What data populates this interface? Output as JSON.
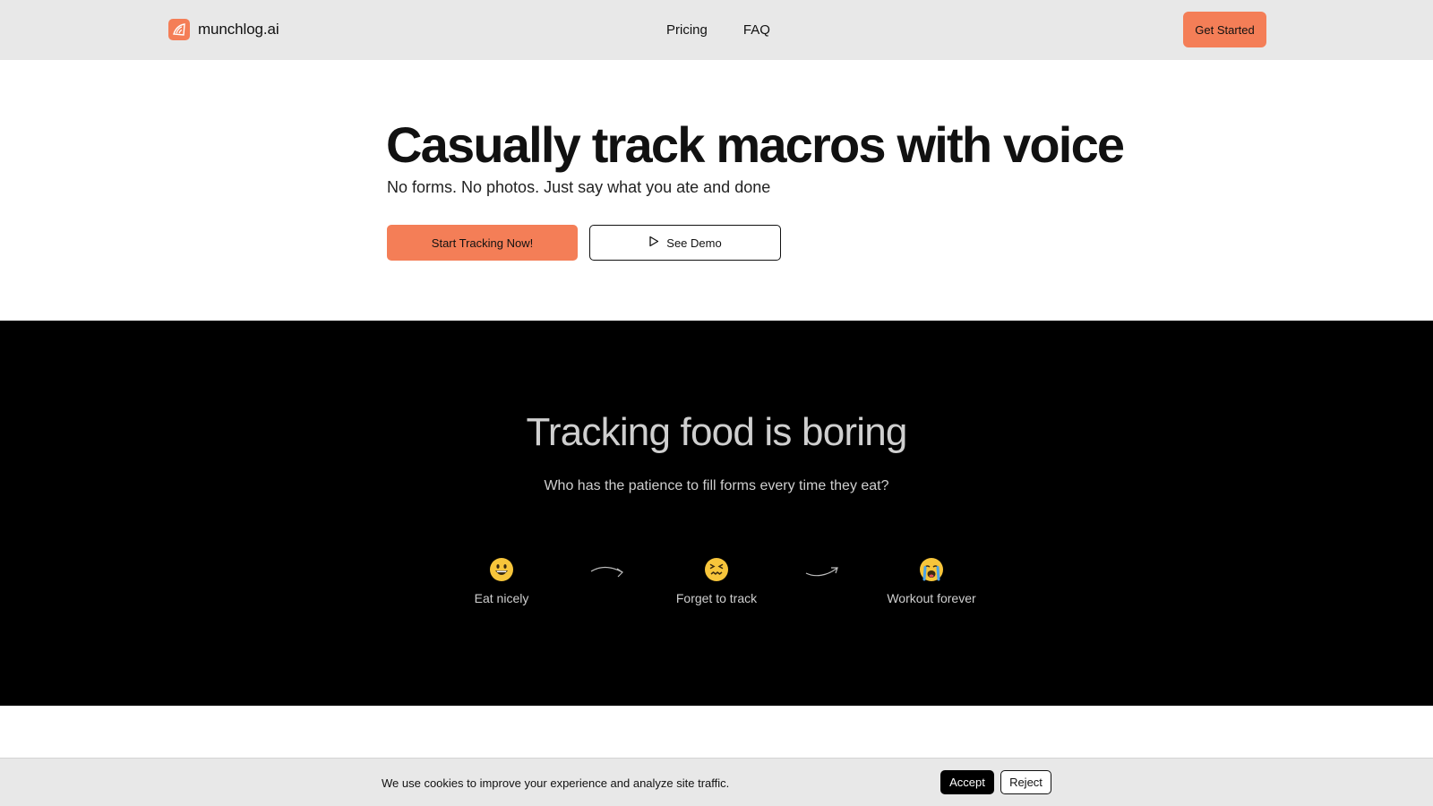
{
  "nav": {
    "brand": "munchlog.ai",
    "logo_icon": "munchlog-logo-icon",
    "links": [
      "Pricing",
      "FAQ"
    ],
    "cta": "Get Started"
  },
  "hero": {
    "title": "Casually track macros with voice",
    "subtitle": "No forms. No photos. Just say what you ate and done",
    "primary_cta": "Start Tracking Now!",
    "secondary_cta": "See Demo",
    "secondary_icon": "play-icon"
  },
  "problem": {
    "title": "Tracking food is boring",
    "subtitle": "Who has the patience to fill forms every time they eat?",
    "steps": [
      {
        "emoji": "grinning-face-icon",
        "label": "Eat nicely"
      },
      {
        "emoji": "confounded-face-icon",
        "label": "Forget to track"
      },
      {
        "emoji": "crying-face-icon",
        "label": "Workout forever"
      }
    ]
  },
  "cookie": {
    "text": "We use cookies to improve your experience and analyze site traffic.",
    "accept": "Accept",
    "reject": "Reject"
  },
  "colors": {
    "accent": "#f47e57",
    "nav_bg": "#e8e8e8",
    "dark_bg": "#000000"
  }
}
